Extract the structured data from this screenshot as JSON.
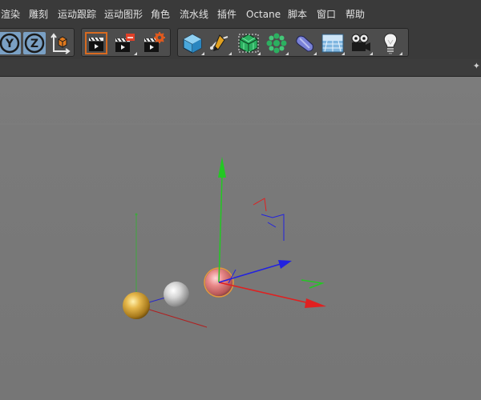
{
  "menubar": {
    "items": [
      {
        "label": "渲染"
      },
      {
        "label": "雕刻"
      },
      {
        "label": "运动跟踪"
      },
      {
        "label": "运动图形"
      },
      {
        "label": "角色"
      },
      {
        "label": "流水线"
      },
      {
        "label": "插件"
      },
      {
        "label": "Octane"
      },
      {
        "label": "脚本"
      },
      {
        "label": "窗口"
      },
      {
        "label": "帮助"
      }
    ]
  },
  "toolbar": {
    "axis_lock": [
      {
        "label": "Y"
      },
      {
        "label": "Z"
      }
    ],
    "icons": [
      "coordinate-system-icon",
      "render-view-icon",
      "render-to-picture-viewer-icon",
      "render-settings-icon",
      "cube-icon",
      "pen-spline-icon",
      "subdivision-surface-icon",
      "cloner-icon",
      "deformer-icon",
      "floor-scene-icon",
      "camera-icon",
      "light-icon"
    ]
  },
  "viewport": {
    "colors": {
      "x_axis": "#e02020",
      "y_axis": "#22c822",
      "z_axis": "#2222e0",
      "gold_sphere": "#d8a838",
      "silver_sphere": "#d0d0d0",
      "pink_sphere": "#e07878",
      "selection_outline": "#e8963a"
    },
    "objects": [
      {
        "name": "gold-sphere",
        "selected": false
      },
      {
        "name": "silver-sphere",
        "selected": false
      },
      {
        "name": "pink-sphere",
        "selected": true
      }
    ]
  }
}
